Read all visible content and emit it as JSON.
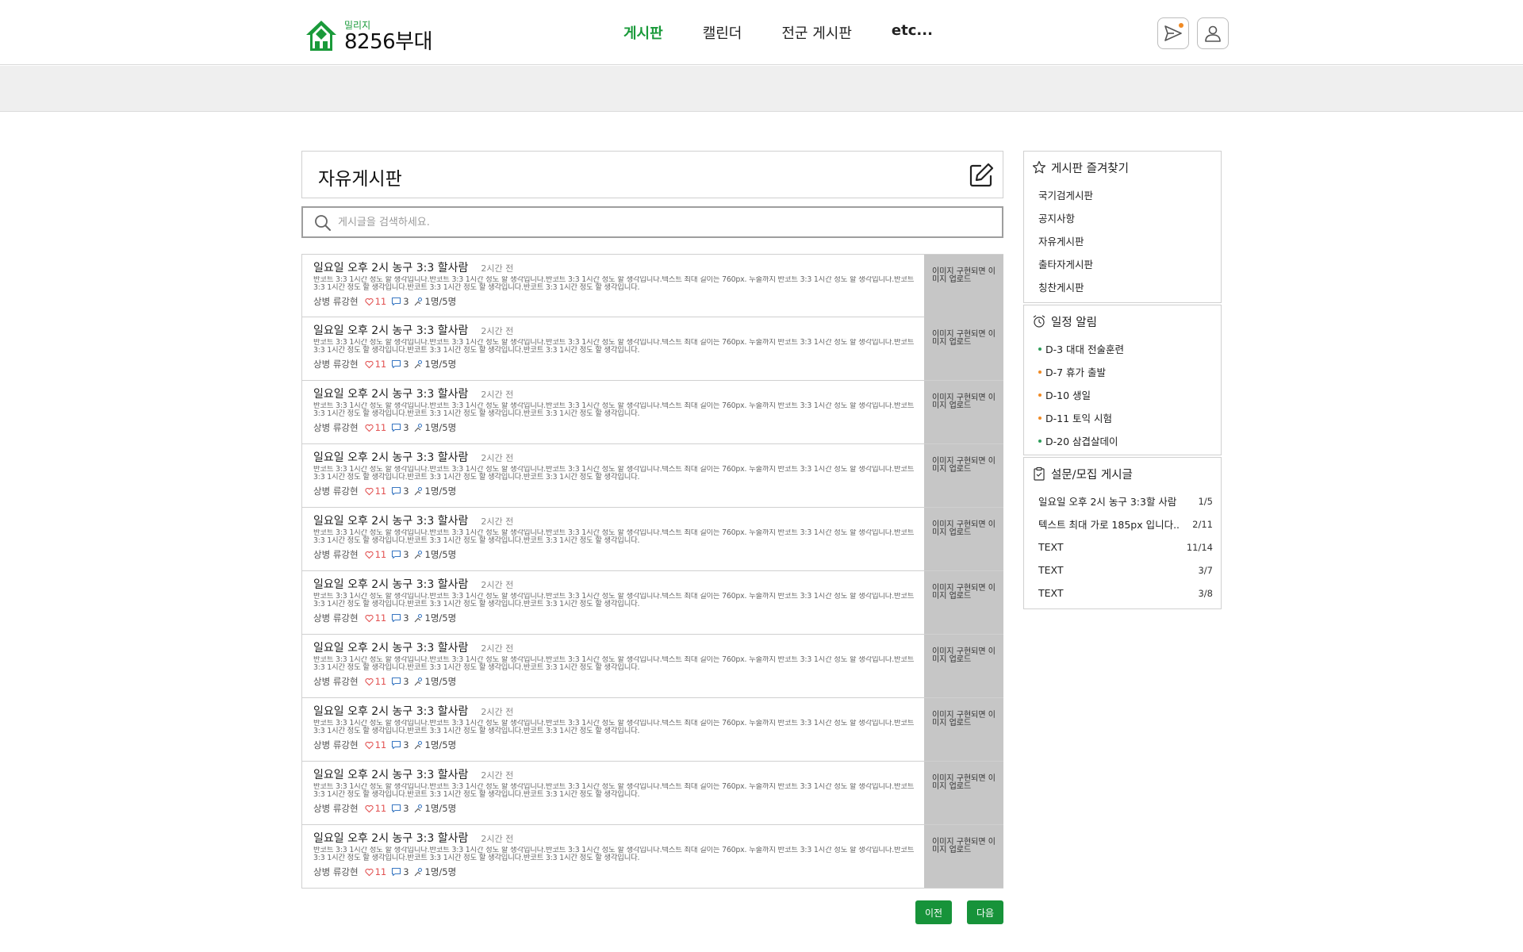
{
  "header": {
    "logo_small": "밀리지",
    "logo_big": "8256부대",
    "nav": [
      {
        "label": "게시판",
        "active": true
      },
      {
        "label": "캘린더",
        "active": false
      },
      {
        "label": "전군 게시판",
        "active": false
      },
      {
        "label": "etc...",
        "active": false
      }
    ],
    "message_icon": "paper-plane-icon",
    "user_icon": "user-icon",
    "accent_color": "#1a9a3a",
    "notification_color": "#f08a24"
  },
  "board": {
    "title": "자유게시판",
    "edit_icon": "edit-icon"
  },
  "search": {
    "placeholder": "게시글을 검색하세요.",
    "value": ""
  },
  "posts": [
    {
      "title": "일요일 오후 2시 농구 3:3 할사람",
      "time": "2시간 전",
      "excerpt": "반코트 3:3 1시간 정도 할 생각입니다.반코트 3:3 1시간 정도 할 생각입니다.반코트 3:3 1시간 정도 할 생각입니다.텍스트 최대 길이는 760px. 두줄까지 반코트 3:3 1시간 정도 할 생각입니다.반코트 3:3 1시간 정도 할 생각입니다.반코트 3:3 1시간 정도 할 생각입니다.반코트 3:3 1시간 정도 할 생각입니다.",
      "author": "상병 류강현",
      "likes": "11",
      "comments": "3",
      "members": "1명/5명",
      "thumb": "이미지 구현되면 이미지 업로드"
    },
    {
      "title": "일요일 오후 2시 농구 3:3 할사람",
      "time": "2시간 전",
      "excerpt": "반코트 3:3 1시간 정도 할 생각입니다.반코트 3:3 1시간 정도 할 생각입니다.반코트 3:3 1시간 정도 할 생각입니다.텍스트 최대 길이는 760px. 두줄까지 반코트 3:3 1시간 정도 할 생각입니다.반코트 3:3 1시간 정도 할 생각입니다.반코트 3:3 1시간 정도 할 생각입니다.반코트 3:3 1시간 정도 할 생각입니다.",
      "author": "상병 류강현",
      "likes": "11",
      "comments": "3",
      "members": "1명/5명",
      "thumb": "이미지 구현되면 이미지 업로드"
    },
    {
      "title": "일요일 오후 2시 농구 3:3 할사람",
      "time": "2시간 전",
      "excerpt": "반코트 3:3 1시간 정도 할 생각입니다.반코트 3:3 1시간 정도 할 생각입니다.반코트 3:3 1시간 정도 할 생각입니다.텍스트 최대 길이는 760px. 두줄까지 반코트 3:3 1시간 정도 할 생각입니다.반코트 3:3 1시간 정도 할 생각입니다.반코트 3:3 1시간 정도 할 생각입니다.반코트 3:3 1시간 정도 할 생각입니다.",
      "author": "상병 류강현",
      "likes": "11",
      "comments": "3",
      "members": "1명/5명",
      "thumb": "이미지 구현되면 이미지 업로드"
    },
    {
      "title": "일요일 오후 2시 농구 3:3 할사람",
      "time": "2시간 전",
      "excerpt": "반코트 3:3 1시간 정도 할 생각입니다.반코트 3:3 1시간 정도 할 생각입니다.반코트 3:3 1시간 정도 할 생각입니다.텍스트 최대 길이는 760px. 두줄까지 반코트 3:3 1시간 정도 할 생각입니다.반코트 3:3 1시간 정도 할 생각입니다.반코트 3:3 1시간 정도 할 생각입니다.반코트 3:3 1시간 정도 할 생각입니다.",
      "author": "상병 류강현",
      "likes": "11",
      "comments": "3",
      "members": "1명/5명",
      "thumb": "이미지 구현되면 이미지 업로드"
    },
    {
      "title": "일요일 오후 2시 농구 3:3 할사람",
      "time": "2시간 전",
      "excerpt": "반코트 3:3 1시간 정도 할 생각입니다.반코트 3:3 1시간 정도 할 생각입니다.반코트 3:3 1시간 정도 할 생각입니다.텍스트 최대 길이는 760px. 두줄까지 반코트 3:3 1시간 정도 할 생각입니다.반코트 3:3 1시간 정도 할 생각입니다.반코트 3:3 1시간 정도 할 생각입니다.반코트 3:3 1시간 정도 할 생각입니다.",
      "author": "상병 류강현",
      "likes": "11",
      "comments": "3",
      "members": "1명/5명",
      "thumb": "이미지 구현되면 이미지 업로드"
    },
    {
      "title": "일요일 오후 2시 농구 3:3 할사람",
      "time": "2시간 전",
      "excerpt": "반코트 3:3 1시간 정도 할 생각입니다.반코트 3:3 1시간 정도 할 생각입니다.반코트 3:3 1시간 정도 할 생각입니다.텍스트 최대 길이는 760px. 두줄까지 반코트 3:3 1시간 정도 할 생각입니다.반코트 3:3 1시간 정도 할 생각입니다.반코트 3:3 1시간 정도 할 생각입니다.반코트 3:3 1시간 정도 할 생각입니다.",
      "author": "상병 류강현",
      "likes": "11",
      "comments": "3",
      "members": "1명/5명",
      "thumb": "이미지 구현되면 이미지 업로드"
    },
    {
      "title": "일요일 오후 2시 농구 3:3 할사람",
      "time": "2시간 전",
      "excerpt": "반코트 3:3 1시간 정도 할 생각입니다.반코트 3:3 1시간 정도 할 생각입니다.반코트 3:3 1시간 정도 할 생각입니다.텍스트 최대 길이는 760px. 두줄까지 반코트 3:3 1시간 정도 할 생각입니다.반코트 3:3 1시간 정도 할 생각입니다.반코트 3:3 1시간 정도 할 생각입니다.반코트 3:3 1시간 정도 할 생각입니다.",
      "author": "상병 류강현",
      "likes": "11",
      "comments": "3",
      "members": "1명/5명",
      "thumb": "이미지 구현되면 이미지 업로드"
    },
    {
      "title": "일요일 오후 2시 농구 3:3 할사람",
      "time": "2시간 전",
      "excerpt": "반코트 3:3 1시간 정도 할 생각입니다.반코트 3:3 1시간 정도 할 생각입니다.반코트 3:3 1시간 정도 할 생각입니다.텍스트 최대 길이는 760px. 두줄까지 반코트 3:3 1시간 정도 할 생각입니다.반코트 3:3 1시간 정도 할 생각입니다.반코트 3:3 1시간 정도 할 생각입니다.반코트 3:3 1시간 정도 할 생각입니다.",
      "author": "상병 류강현",
      "likes": "11",
      "comments": "3",
      "members": "1명/5명",
      "thumb": "이미지 구현되면 이미지 업로드"
    },
    {
      "title": "일요일 오후 2시 농구 3:3 할사람",
      "time": "2시간 전",
      "excerpt": "반코트 3:3 1시간 정도 할 생각입니다.반코트 3:3 1시간 정도 할 생각입니다.반코트 3:3 1시간 정도 할 생각입니다.텍스트 최대 길이는 760px. 두줄까지 반코트 3:3 1시간 정도 할 생각입니다.반코트 3:3 1시간 정도 할 생각입니다.반코트 3:3 1시간 정도 할 생각입니다.반코트 3:3 1시간 정도 할 생각입니다.",
      "author": "상병 류강현",
      "likes": "11",
      "comments": "3",
      "members": "1명/5명",
      "thumb": "이미지 구현되면 이미지 업로드"
    },
    {
      "title": "일요일 오후 2시 농구 3:3 할사람",
      "time": "2시간 전",
      "excerpt": "반코트 3:3 1시간 정도 할 생각입니다.반코트 3:3 1시간 정도 할 생각입니다.반코트 3:3 1시간 정도 할 생각입니다.텍스트 최대 길이는 760px. 두줄까지 반코트 3:3 1시간 정도 할 생각입니다.반코트 3:3 1시간 정도 할 생각입니다.반코트 3:3 1시간 정도 할 생각입니다.반코트 3:3 1시간 정도 할 생각입니다.",
      "author": "상병 류강현",
      "likes": "11",
      "comments": "3",
      "members": "1명/5명",
      "thumb": "이미지 구현되면 이미지 업로드"
    }
  ],
  "pager": {
    "prev_label": "이전",
    "next_label": "다음"
  },
  "sidebar": {
    "favorites": {
      "title": "게시판 즐겨찾기",
      "icon": "star-icon",
      "items": [
        "국기검게시판",
        "공지사항",
        "자유게시판",
        "출타자게시판",
        "칭찬게시판"
      ]
    },
    "schedule": {
      "title": "일정 알림",
      "icon": "alarm-clock-icon",
      "items": [
        {
          "label": "D-3 대대 전술훈련",
          "color": "#2e9d5a"
        },
        {
          "label": "D-7 휴가 출발",
          "color": "#f08a24"
        },
        {
          "label": "D-10 생일",
          "color": "#f08a24"
        },
        {
          "label": "D-11 토익 시험",
          "color": "#f08a24"
        },
        {
          "label": "D-20 삼겹살데이",
          "color": "#2e9d5a"
        }
      ]
    },
    "survey": {
      "title": "설문/모집 게시글",
      "icon": "clipboard-icon",
      "items": [
        {
          "label": "일요일 오후 2시 농구 3:3할 사람",
          "count": "1/5"
        },
        {
          "label": "텍스트 최대 가로 185px 입니다..",
          "count": "2/11"
        },
        {
          "label": "TEXT",
          "count": "11/14"
        },
        {
          "label": "TEXT",
          "count": "3/7"
        },
        {
          "label": "TEXT",
          "count": "3/8"
        }
      ]
    }
  }
}
